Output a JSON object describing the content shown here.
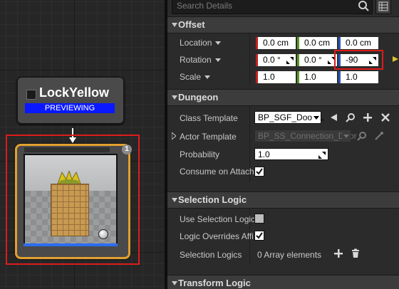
{
  "graph": {
    "lock_node": {
      "title": "LockYellow",
      "badge": "PREVIEWING"
    },
    "room_node": {
      "count": "1"
    }
  },
  "details": {
    "search_placeholder": "Search Details",
    "offset": {
      "title": "Offset",
      "location": {
        "label": "Location",
        "x": "0.0 cm",
        "y": "0.0 cm",
        "z": "0.0 cm"
      },
      "rotation": {
        "label": "Rotation",
        "x": "0.0 °",
        "y": "0.0 °",
        "z": "-90"
      },
      "scale": {
        "label": "Scale",
        "x": "1.0",
        "y": "1.0",
        "z": "1.0"
      }
    },
    "dungeon": {
      "title": "Dungeon",
      "class_template": {
        "label": "Class Template",
        "value": "BP_SGF_Door_L"
      },
      "actor_template": {
        "label": "Actor Template",
        "value": "BP_SS_Connection_Door"
      },
      "probability": {
        "label": "Probability",
        "value": "1.0"
      },
      "consume_on_attach": {
        "label": "Consume on Attach",
        "checked": true
      }
    },
    "selection_logic": {
      "title": "Selection Logic",
      "use_selection_logic": {
        "label": "Use Selection Logic",
        "checked": false
      },
      "logic_overrides": {
        "label": "Logic Overrides Affi",
        "checked": true
      },
      "selection_logics": {
        "label": "Selection Logics",
        "value": "0 Array elements"
      }
    },
    "transform_logic": {
      "title": "Transform Logic"
    }
  },
  "colors": {
    "highlight": "#dd1c1c",
    "node_border": "#e2a030",
    "badge": "#0a18ff"
  }
}
